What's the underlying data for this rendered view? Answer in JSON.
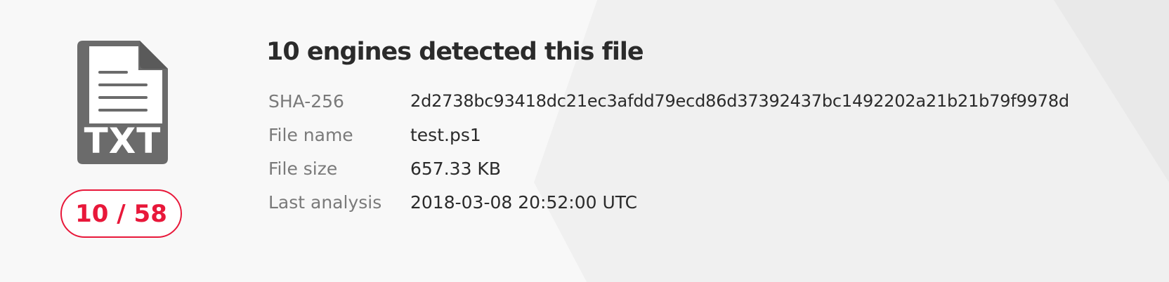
{
  "file": {
    "type_label": "TXT",
    "icon": "text-file-icon"
  },
  "detection": {
    "score": "10 / 58",
    "headline": "10 engines detected this file"
  },
  "details": [
    {
      "label": "SHA-256",
      "value": "2d2738bc93418dc21ec3afdd79ecd86d37392437bc1492202a21b21b79f9978d"
    },
    {
      "label": "File name",
      "value": "test.ps1"
    },
    {
      "label": "File size",
      "value": "657.33 KB"
    },
    {
      "label": "Last analysis",
      "value": "2018-03-08 20:52:00 UTC"
    }
  ],
  "colors": {
    "accent": "#e8183a",
    "icon": "#6b6b6b",
    "text": "#2b2b2b",
    "label": "#7a7a7a",
    "background": "#f7f7f7"
  }
}
